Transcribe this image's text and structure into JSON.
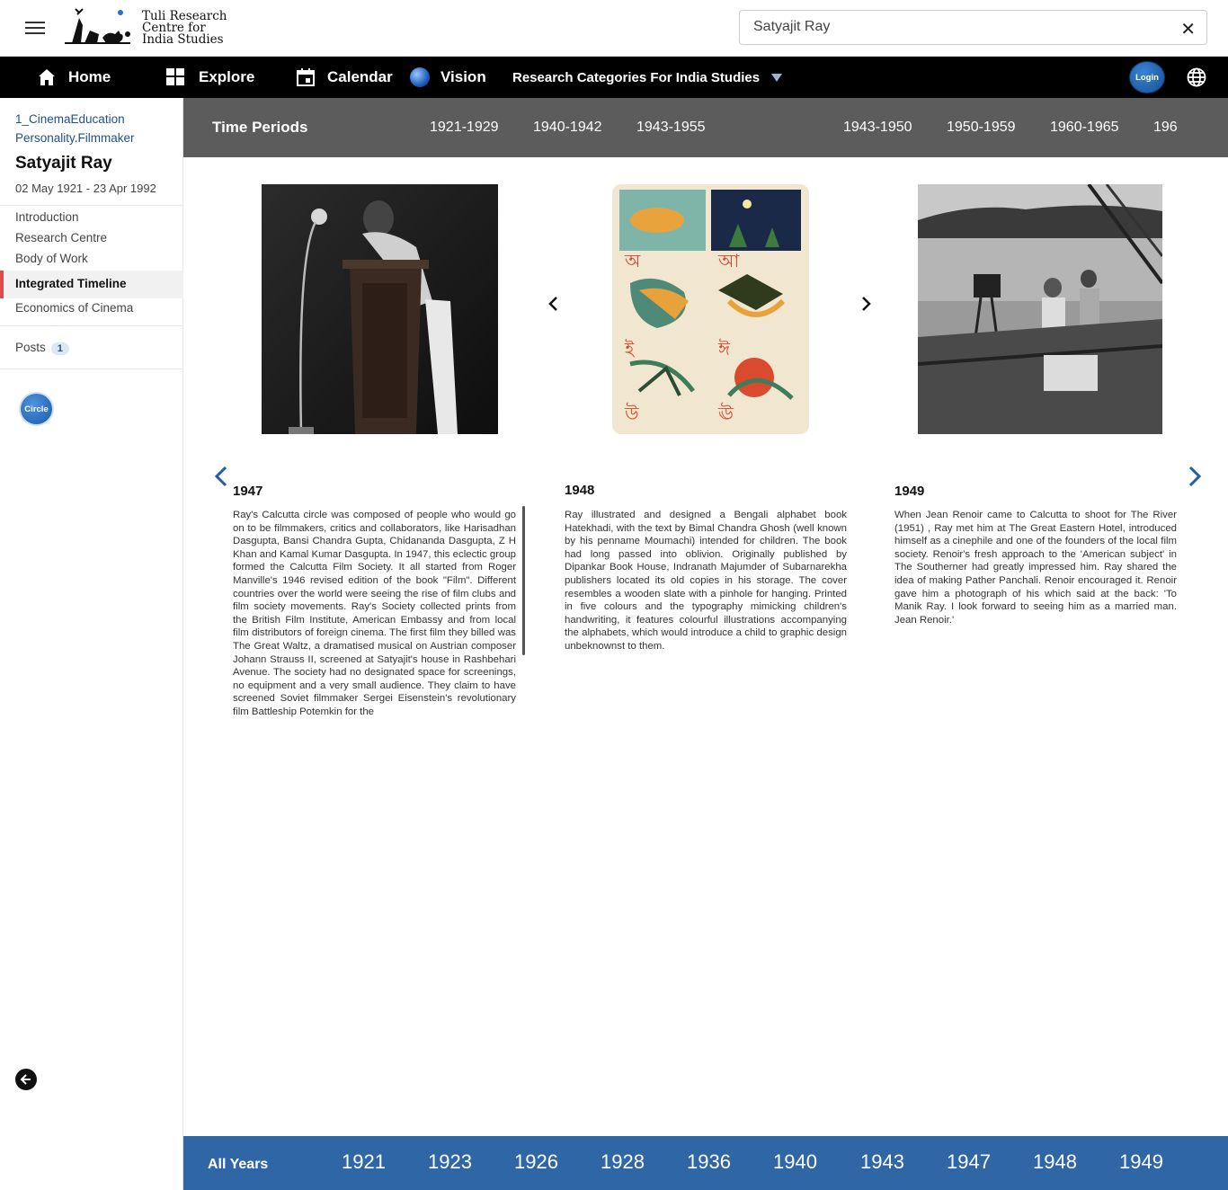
{
  "header": {
    "logo_text": [
      "Tuli Research",
      "Centre for",
      "India Studies"
    ],
    "search_value": "Satyajit Ray",
    "clear_glyph": "✕"
  },
  "nav": {
    "home": "Home",
    "explore": "Explore",
    "calendar": "Calendar",
    "vision": "Vision",
    "research": "Research Categories For India Studies",
    "login": "Login"
  },
  "sidebar": {
    "crumb_1": "1_CinemaEducation",
    "crumb_2": "Personality.Filmmaker",
    "name": "Satyajit Ray",
    "dates": "02 May 1921 - 23 Apr 1992",
    "links": [
      "Introduction",
      "Research Centre",
      "Body of Work",
      "Integrated Timeline",
      "Economics of Cinema"
    ],
    "posts_label": "Posts",
    "posts_count": "1",
    "circle_label": "Circle"
  },
  "periods": {
    "title": "Time Periods",
    "items": [
      "1921-1929",
      "1940-1942",
      "1943-1955",
      "1943-1950",
      "1950-1959",
      "1960-1965",
      "196"
    ]
  },
  "entries": [
    {
      "year": "1947",
      "text": "Ray's Calcutta circle was composed of people who would go on to be filmmakers, critics and collaborators, like Harisadhan Dasgupta, Bansi Chandra Gupta, Chidananda Dasgupta, Z H Khan and Kamal Kumar Dasgupta. In 1947, this eclectic group formed the Calcutta Film Society. It all started from Roger Manville's 1946 revised edition of the book \"Film\". Different countries over the world were seeing the rise of film clubs and film society movements. Ray's Society collected prints from the British Film Institute, American Embassy and from local film distributors of foreign cinema. The first film they billed was The Great Waltz, a dramatised musical on Austrian composer Johann Strauss II, screened at Satyajit's house in Rashbehari Avenue. The society had no designated space for screenings, no equipment and a very small audience. They claim to have screened Soviet filmmaker Sergei Eisenstein's revolutionary film Battleship Potemkin for the"
    },
    {
      "year": "1948",
      "text": "Ray illustrated and designed a Bengali alphabet book Hatekhadi, with the text by Bimal Chandra Ghosh (well known by his penname Moumachi) intended for children. The book had long passed into oblivion. Originally published by Dipankar Book House, Indranath Majumder of Subarnarekha publishers located its old copies in his storage. The cover resembles a wooden slate with a pinhole for hanging. Printed in five colours and the typography mimicking children's handwriting, it features colourful illustrations accompanying the alphabets, which would introduce a child to graphic design unbeknownst to them."
    },
    {
      "year": "1949",
      "text": "When Jean Renoir came to Calcutta to shoot for The River (1951) , Ray met him at The Great Eastern Hotel, introduced himself as a cinephile and one of the founders of the local film society. Renoir's fresh approach to the 'American subject' in The Southerner had greatly impressed him. Ray shared the idea of making Pather Panchali. Renoir encouraged it. Renoir gave him a photograph of his which said at the back: 'To Manik Ray. I look forward to seeing him as a married man. Jean Renoir.'"
    }
  ],
  "years_bar": {
    "title": "All Years",
    "items": [
      "1921",
      "1923",
      "1926",
      "1928",
      "1936",
      "1940",
      "1943",
      "1947",
      "1948",
      "1949"
    ]
  }
}
